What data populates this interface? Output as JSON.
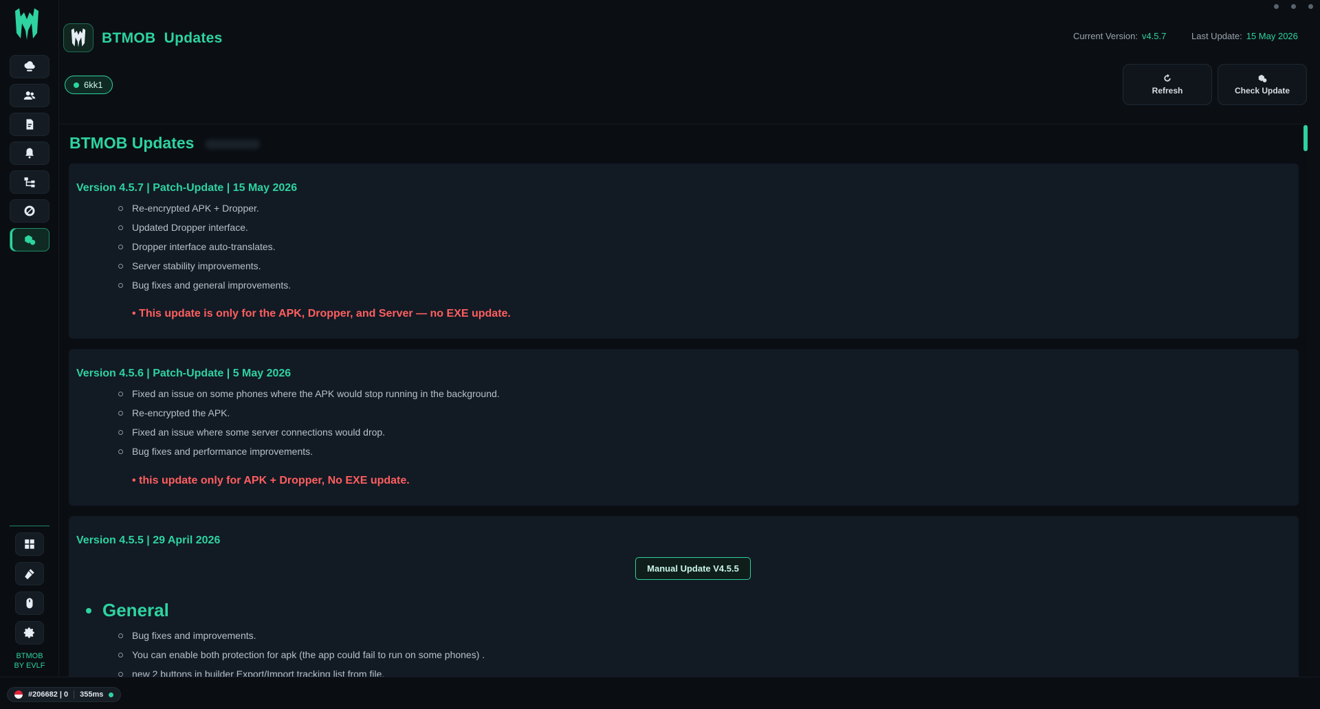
{
  "app": {
    "title": "BTMOB Updates",
    "current_version_label": "Current Version:",
    "current_version": "v4.5.7",
    "last_update_label": "Last Update:",
    "last_update": "15 May 2026",
    "client_chip": "6kk1",
    "accent_color": "#2ed3a0",
    "warning_color": "#ff5f5f"
  },
  "toolbar": {
    "refresh_label": "Refresh",
    "check_update_label": "Check Update"
  },
  "sidebar": {
    "items": [
      {
        "icon": "cloud-server-icon"
      },
      {
        "icon": "users-icon"
      },
      {
        "icon": "document-icon"
      },
      {
        "icon": "bell-icon"
      },
      {
        "icon": "network-icon"
      },
      {
        "icon": "block-icon"
      },
      {
        "icon": "updates-icon",
        "active": true
      }
    ],
    "bottom_items": [
      {
        "icon": "apps-icon"
      },
      {
        "icon": "tools-icon"
      },
      {
        "icon": "mouse-icon"
      },
      {
        "icon": "gear-icon"
      }
    ],
    "brand_line1": "BTMOB",
    "brand_line2": "BY EVLF"
  },
  "main": {
    "section_title": "BTMOB Updates",
    "releases": [
      {
        "heading": "Version 4.5.7 | Patch-Update | 15 May 2026",
        "items": [
          "Re-encrypted APK + Dropper.",
          "Updated Dropper interface.",
          "Dropper interface auto-translates.",
          "Server stability improvements.",
          "Bug fixes and general improvements."
        ],
        "note": "• This update is only for the APK, Dropper, and Server — no EXE update."
      },
      {
        "heading": "Version 4.5.6 | Patch-Update | 5 May 2026",
        "items": [
          "Fixed an issue on some phones where the APK would stop running in the background.",
          "Re-encrypted the APK.",
          "Fixed an issue where some server connections would drop.",
          "Bug fixes and performance improvements."
        ],
        "note": "• this update only for APK + Dropper, No EXE update."
      },
      {
        "heading": "Version 4.5.5 | 29 April 2026",
        "manual_button": "Manual Update V4.5.5",
        "general_title": "General",
        "items": [
          "Bug fixes and improvements.",
          "You can enable both protection for apk (the app could fail to run on some phones) .",
          "new 2 buttons in builder Export/Import tracking list from file."
        ]
      }
    ]
  },
  "status": {
    "session": "#206682 | 0",
    "latency": "355ms"
  }
}
